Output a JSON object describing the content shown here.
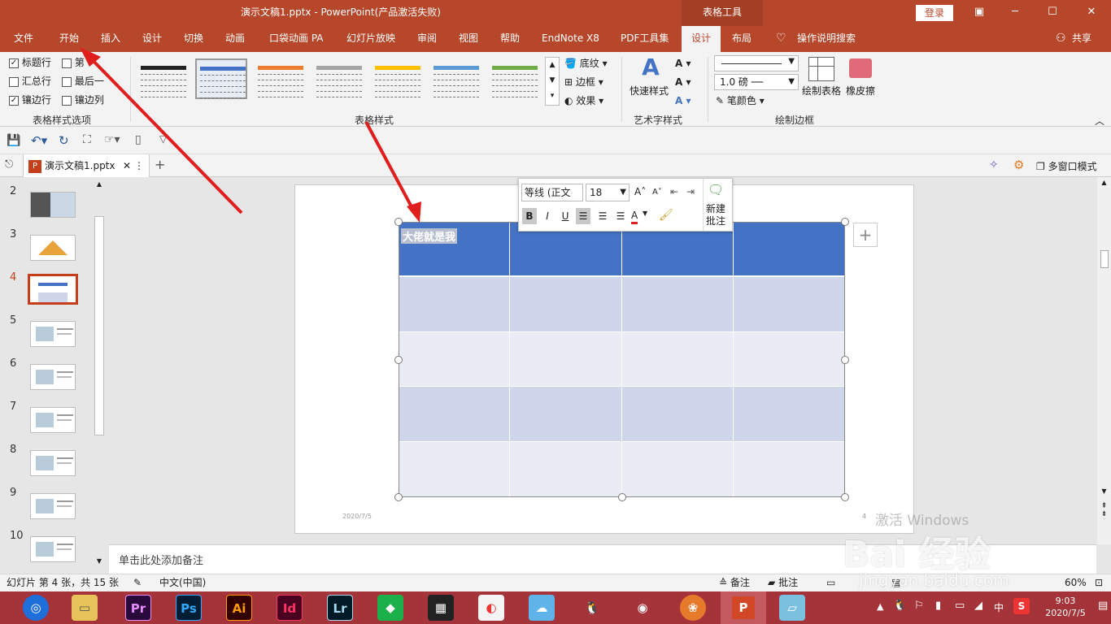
{
  "titlebar": {
    "title": "演示文稿1.pptx  -  PowerPoint(产品激活失败)",
    "context_tab": "表格工具",
    "login": "登录",
    "restore_icon": "▣",
    "min_icon": "─",
    "max_icon": "☐",
    "close_icon": "✕"
  },
  "tabs": [
    "文件",
    "开始",
    "插入",
    "设计",
    "切换",
    "动画",
    "口袋动画 PA",
    "幻灯片放映",
    "审阅",
    "视图",
    "帮助",
    "EndNote X8",
    "PDF工具集",
    "设计",
    "布局"
  ],
  "tell_me": "操作说明搜索",
  "share": "共享",
  "ribbon": {
    "options": {
      "header_row": "标题行",
      "first_col": "第一列",
      "total_row": "汇总行",
      "last_col": "最后一列",
      "banded_rows": "镶边行",
      "banded_cols": "镶边列",
      "group": "表格样式选项",
      "first_col_visible": "第",
      "last_col_visible": "最后一"
    },
    "styles": {
      "group": "表格样式",
      "shading": "底纹",
      "border": "边框",
      "effects": "效果",
      "colors": [
        "#222222",
        "#4472c4",
        "#ed7d31",
        "#a5a5a5",
        "#ffc000",
        "#5b9bd5",
        "#70ad47"
      ]
    },
    "wordart": {
      "quick": "快速样式",
      "group": "艺术字样式"
    },
    "draw": {
      "weight": "1.0 磅",
      "pen_color": "笔颜色",
      "draw_table": "绘制表格",
      "eraser": "橡皮擦",
      "group": "绘制边框"
    }
  },
  "doctab": {
    "name": "演示文稿1.pptx",
    "multi": "多窗口模式"
  },
  "thumbs": {
    "numbers": [
      "2",
      "3",
      "4",
      "5",
      "6",
      "7",
      "8",
      "9",
      "10"
    ]
  },
  "slide": {
    "cell_text": "大佬就是我",
    "date": "2020/7/5",
    "page": "4"
  },
  "minitb": {
    "font": "等线 (正文",
    "size": "18",
    "new_comment_1": "新建",
    "new_comment_2": "批注",
    "bold": "B",
    "italic": "I",
    "underline": "U",
    "font_color": "A"
  },
  "notes": {
    "placeholder": "单击此处添加备注"
  },
  "status": {
    "slide": "幻灯片 第 4 张，共 15 张",
    "lang": "中文(中国)",
    "notes": "备注",
    "comments": "批注",
    "zoom": "60%"
  },
  "watermark": {
    "line1": "激活 Windows",
    "line2": "Bai 经验",
    "line3": "jingyan.baidu.com"
  },
  "taskbar": {
    "icons": [
      "Pr",
      "Ps",
      "Ai",
      "Id",
      "Lr"
    ],
    "time": "9:03",
    "date": "2020/7/5",
    "ime": "中"
  }
}
